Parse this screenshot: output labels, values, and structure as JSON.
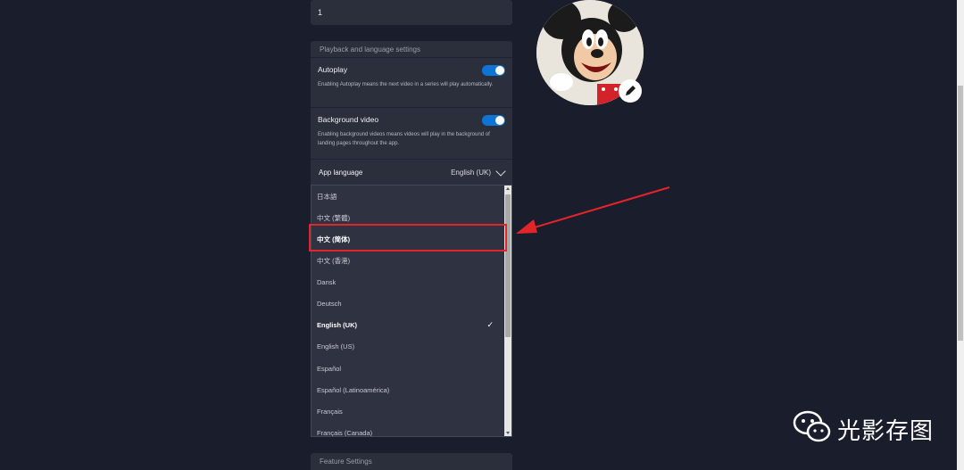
{
  "top_field": {
    "value": "1"
  },
  "playback": {
    "header": "Playback and language settings",
    "autoplay": {
      "title": "Autoplay",
      "description": "Enabling Autoplay means the next video in a series will play automatically.",
      "enabled": true
    },
    "background_video": {
      "title": "Background video",
      "description": "Enabling background videos means videos will play in the background of landing pages throughout the app.",
      "enabled": true
    }
  },
  "app_language": {
    "label": "App language",
    "selected": "English (UK)",
    "options": [
      {
        "label": "日本語"
      },
      {
        "label": "中文 (繁體)"
      },
      {
        "label": "中文 (简体)"
      },
      {
        "label": "中文 (香港)"
      },
      {
        "label": "Dansk"
      },
      {
        "label": "Deutsch"
      },
      {
        "label": "English (UK)"
      },
      {
        "label": "English (US)"
      },
      {
        "label": "Español"
      },
      {
        "label": "Español (Latinoamérica)"
      },
      {
        "label": "Français"
      },
      {
        "label": "Français (Canada)"
      }
    ],
    "check_glyph": "✓"
  },
  "feature_settings": {
    "header": "Feature Settings"
  },
  "watermark": {
    "text": "光影存图"
  },
  "colors": {
    "background": "#1a1d2b",
    "panel": "#2b2e3b",
    "toggle_on": "#0e75d6",
    "annotation_red": "#e3252a"
  }
}
